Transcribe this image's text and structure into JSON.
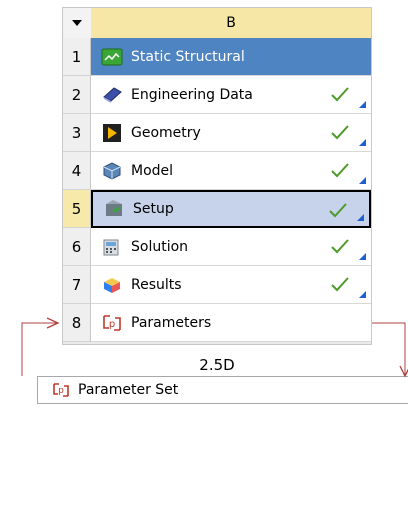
{
  "system": {
    "column_letter": "B",
    "name": "2.5D",
    "rows": [
      {
        "num": "1",
        "label": "Static Structural",
        "icon": "static-structural-icon",
        "status": "",
        "kind": "title"
      },
      {
        "num": "2",
        "label": "Engineering Data",
        "icon": "engineering-data-icon",
        "status": "up-to-date",
        "kind": "normal"
      },
      {
        "num": "3",
        "label": "Geometry",
        "icon": "geometry-icon",
        "status": "up-to-date",
        "kind": "normal"
      },
      {
        "num": "4",
        "label": "Model",
        "icon": "model-icon",
        "status": "up-to-date",
        "kind": "normal"
      },
      {
        "num": "5",
        "label": "Setup",
        "icon": "setup-icon",
        "status": "up-to-date",
        "kind": "selected"
      },
      {
        "num": "6",
        "label": "Solution",
        "icon": "solution-icon",
        "status": "up-to-date",
        "kind": "normal"
      },
      {
        "num": "7",
        "label": "Results",
        "icon": "results-icon",
        "status": "up-to-date",
        "kind": "normal"
      },
      {
        "num": "8",
        "label": "Parameters",
        "icon": "parameters-icon",
        "status": "",
        "kind": "normal"
      }
    ]
  },
  "parameter_set": {
    "label": "Parameter Set",
    "icon": "parameters-icon"
  },
  "colors": {
    "title_bar": "#4f84c3",
    "header": "#f6e7a6",
    "selected_row": "#c7d3ea",
    "check": "#4e9a2a",
    "connector": "#b04040"
  }
}
